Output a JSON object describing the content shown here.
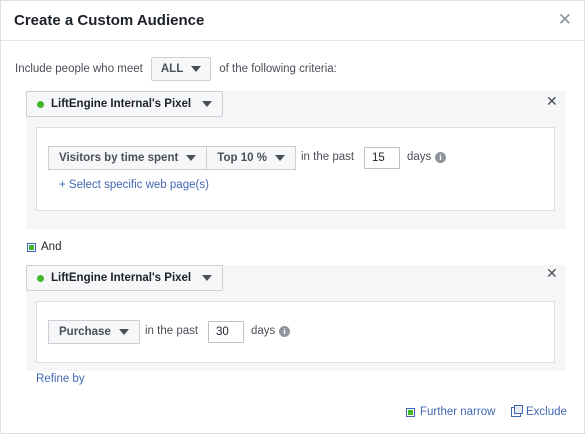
{
  "dialog": {
    "title": "Create a Custom Audience",
    "close_glyph": "✕"
  },
  "criteria": {
    "prefix": "Include people who meet",
    "match_value": "ALL",
    "suffix": "of the following criteria:"
  },
  "rules": [
    {
      "source": "LiftEngine Internal's Pixel",
      "event_label": "Visitors by time spent",
      "percentile_label": "Top 10 %",
      "in_past_label": "in the past",
      "days_value": "15",
      "days_label": "days",
      "link_label": "+ Select specific web page(s)",
      "remove_glyph": "✕"
    },
    {
      "source": "LiftEngine Internal's Pixel",
      "event_label": "Purchase",
      "in_past_label": "in the past",
      "days_value": "30",
      "days_label": "days",
      "remove_glyph": "✕"
    }
  ],
  "joiner": {
    "label": "And"
  },
  "refine_label": "Refine by",
  "footer": {
    "further_narrow_label": "Further narrow",
    "exclude_label": "Exclude"
  },
  "icons": {
    "close": "close-icon",
    "caret": "caret-down-icon",
    "info": "info-icon",
    "status_dot": "green-dot-icon"
  },
  "colors": {
    "link": "#4267b2",
    "status_green": "#42b72a",
    "panel_bg": "#f5f6f7"
  }
}
